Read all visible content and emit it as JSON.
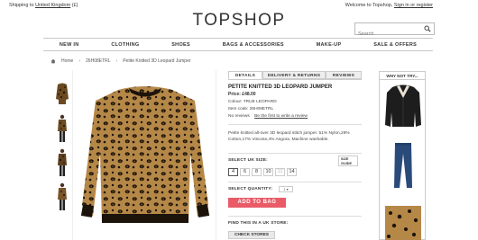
{
  "topbar": {
    "shipping_prefix": "Shipping to ",
    "shipping_country": "United Kingdom",
    "shipping_currency": " (£)",
    "welcome_prefix": "Welcome to Topshop, ",
    "sign_in": "Sign in or register"
  },
  "logo": "TOPSHOP",
  "search": {
    "placeholder": "Search"
  },
  "nav": [
    "NEW IN",
    "CLOTHING",
    "SHOES",
    "BAGS & ACCESSORIES",
    "MAKE-UP",
    "SALE & OFFERS"
  ],
  "breadcrumb": {
    "home": "Home",
    "code": "26H08ETRL",
    "product": "Petite Knitted 3D Leopard Jumper"
  },
  "tabs": [
    "DETAILS",
    "DELIVERY & RETURNS",
    "REVIEWS"
  ],
  "product": {
    "title": "PETITE KNITTED 3D LEOPARD JUMPER",
    "price": "Price: £48.00",
    "colour": "Colour: TRUE LEOPARD",
    "item_code": "Item code: 26H08ETRL",
    "no_reviews": "No reviews",
    "write_review": "Be the first to write a review",
    "description": "Petite knitted all-over 3D leopard stitch jumper. 51% Nylon,28% Cotton,17% Viscose,4% Angora. Machine washable."
  },
  "size_section": {
    "label": "SELECT UK SIZE:",
    "guide_line1": "SIZE",
    "guide_line2": "GUIDE",
    "sizes": [
      "4",
      "6",
      "8",
      "10",
      "12",
      "14"
    ]
  },
  "quantity": {
    "label": "SELECT QUANTITY:",
    "value": "1"
  },
  "add_to_bag": "ADD TO BAG",
  "store": {
    "label": "FIND THIS IN A UK STORE:",
    "button": "CHECK STORES"
  },
  "rail": {
    "title": "WHY NOT TRY..."
  },
  "colors": {
    "accent": "#e85b67",
    "border": "#cccccc"
  }
}
